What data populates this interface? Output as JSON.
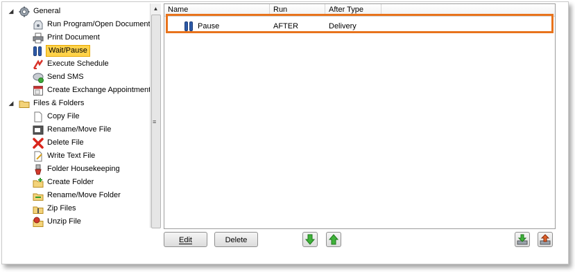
{
  "tree": {
    "groups": [
      {
        "label": "General",
        "icon": "gear-icon",
        "items": [
          {
            "label": "Run Program/Open Document",
            "icon": "run-program-icon"
          },
          {
            "label": "Print Document",
            "icon": "printer-icon"
          },
          {
            "label": "Wait/Pause",
            "icon": "pause-icon",
            "selected": true
          },
          {
            "label": "Execute Schedule",
            "icon": "execute-schedule-icon"
          },
          {
            "label": "Send SMS",
            "icon": "sms-icon"
          },
          {
            "label": "Create Exchange Appointment",
            "icon": "calendar-icon"
          }
        ]
      },
      {
        "label": "Files & Folders",
        "icon": "folder-icon",
        "items": [
          {
            "label": "Copy File",
            "icon": "file-icon"
          },
          {
            "label": "Rename/Move File",
            "icon": "rename-file-icon"
          },
          {
            "label": "Delete File",
            "icon": "delete-icon"
          },
          {
            "label": "Write Text File",
            "icon": "write-file-icon"
          },
          {
            "label": "Folder Housekeeping",
            "icon": "housekeeping-icon"
          },
          {
            "label": "Create Folder",
            "icon": "create-folder-icon"
          },
          {
            "label": "Rename/Move Folder",
            "icon": "rename-folder-icon"
          },
          {
            "label": "Zip Files",
            "icon": "zip-icon"
          },
          {
            "label": "Unzip File",
            "icon": "unzip-icon"
          }
        ]
      }
    ]
  },
  "list": {
    "columns": [
      "Name",
      "Run",
      "After Type"
    ],
    "rows": [
      {
        "name": "Pause",
        "run": "AFTER",
        "after_type": "Delivery"
      }
    ]
  },
  "buttons": {
    "edit": "Edit",
    "delete": "Delete"
  },
  "colors": {
    "highlight": "#e8731c",
    "selection": "#ffd24a",
    "pause": "#2d5aa8"
  }
}
